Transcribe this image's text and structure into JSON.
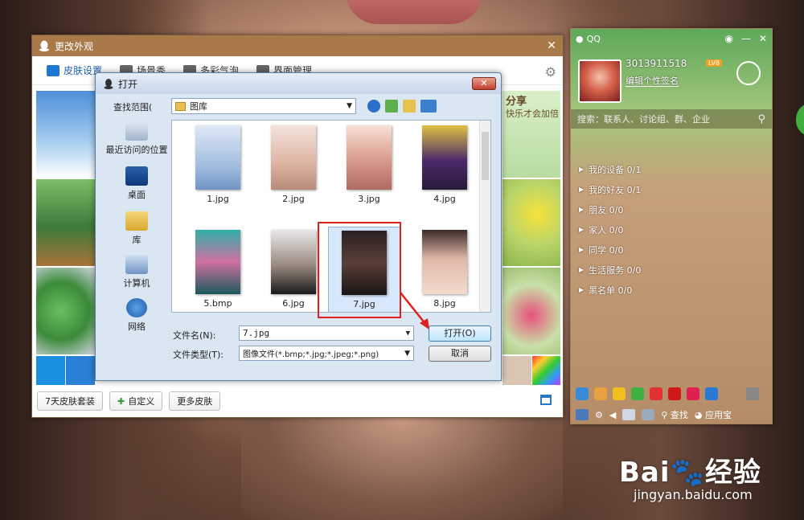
{
  "change_appearance_window": {
    "title": "更改外观",
    "tabs": [
      {
        "label": "皮肤设置"
      },
      {
        "label": "场景秀"
      },
      {
        "label": "多彩气泡"
      },
      {
        "label": "界面管理"
      }
    ],
    "buttons": {
      "seven_day": "7天皮肤套装",
      "custom": "自定义",
      "more": "更多皮肤"
    }
  },
  "open_dialog": {
    "title": "打开",
    "look_in_label": "查找范围(",
    "look_in_value": "图库",
    "places": [
      {
        "label": "最近访问的位置",
        "icon": "recent-places-icon"
      },
      {
        "label": "桌面",
        "icon": "desktop-icon"
      },
      {
        "label": "库",
        "icon": "library-icon"
      },
      {
        "label": "计算机",
        "icon": "computer-icon"
      },
      {
        "label": "网络",
        "icon": "network-icon"
      }
    ],
    "files": [
      {
        "name": "1.jpg"
      },
      {
        "name": "2.jpg"
      },
      {
        "name": "3.jpg"
      },
      {
        "name": "4.jpg"
      },
      {
        "name": "5.bmp"
      },
      {
        "name": "6.jpg"
      },
      {
        "name": "7.jpg",
        "selected": true
      },
      {
        "name": "8.jpg"
      }
    ],
    "filename_label": "文件名(N):",
    "filename_value": "7.jpg",
    "filetype_label": "文件类型(T):",
    "filetype_value": "图像文件(*.bmp;*.jpg;*.jpeg;*.png)",
    "open_button": "打开(O)",
    "cancel_button": "取消"
  },
  "qq_panel": {
    "title": "QQ",
    "uid": "3013911518",
    "level_badge": "LV8",
    "signature": "编辑个性签名",
    "search_placeholder": "搜索：联系人、讨论组、群、企业",
    "groups": [
      {
        "label": "我的设备 0/1"
      },
      {
        "label": "我的好友 0/1"
      },
      {
        "label": "朋友 0/0"
      },
      {
        "label": "家人 0/0"
      },
      {
        "label": "同学 0/0"
      },
      {
        "label": "生活服务 0/0"
      },
      {
        "label": "黑名单 0/0"
      }
    ],
    "bottom": {
      "find": "查找",
      "app_store": "应用宝"
    },
    "skin_text_1": "分享",
    "skin_text_2": "快乐才会加倍"
  },
  "watermark": {
    "brand": "Bai",
    "brand_cn": "经验",
    "url": "jingyan.baidu.com"
  },
  "colors": {
    "qq_brown": "#a87a4a",
    "highlight_red": "#e0201e",
    "selection_blue": "#d7e8fb"
  }
}
